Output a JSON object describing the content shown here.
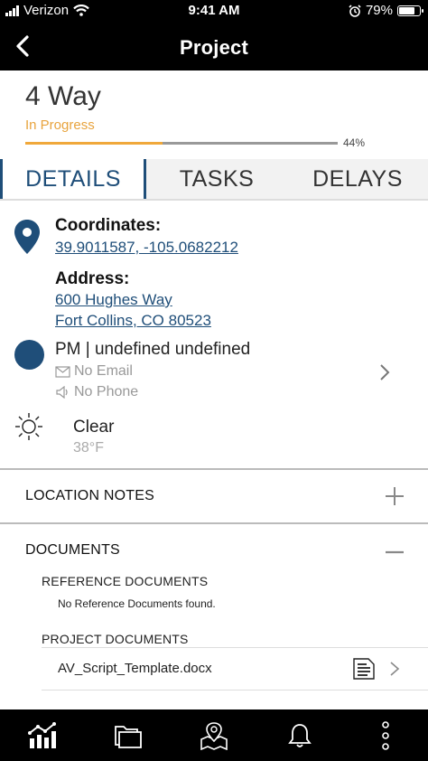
{
  "status_bar": {
    "carrier": "Verizon",
    "time": "9:41 AM",
    "battery": "79%",
    "battery_level": 0.79
  },
  "nav": {
    "title": "Project",
    "back_icon": "chevron-left-icon"
  },
  "project": {
    "name": "4 Way",
    "status": "In Progress",
    "progress": 0.44,
    "progress_label": "44%"
  },
  "tabs": [
    {
      "label": "DETAILS",
      "active": true
    },
    {
      "label": "TASKS",
      "active": false
    },
    {
      "label": "DELAYS",
      "active": false
    }
  ],
  "details": {
    "coordinates_label": "Coordinates:",
    "coordinates_value": "39.9011587, -105.0682212",
    "address_label": "Address:",
    "address_line1": "600 Hughes Way",
    "address_line2": "Fort Collins, CO 80523",
    "pm_line": "PM | undefined undefined",
    "pm_email": "No Email",
    "pm_phone": "No Phone",
    "weather_condition": "Clear",
    "weather_temp": "38°F"
  },
  "sections": {
    "location_notes": "LOCATION NOTES",
    "documents": "DOCUMENTS",
    "reference_documents": "REFERENCE DOCUMENTS",
    "reference_empty": "No Reference Documents found.",
    "project_documents": "PROJECT DOCUMENTS",
    "project_document_files": [
      "AV_Script_Template.docx"
    ]
  },
  "colors": {
    "brand": "#1f4e79",
    "status": "#e8a33d",
    "bar": "#000000"
  },
  "bottom_bar": [
    "chart-icon",
    "folder-icon",
    "map-pin-icon",
    "bell-icon",
    "more-vertical-icon"
  ]
}
